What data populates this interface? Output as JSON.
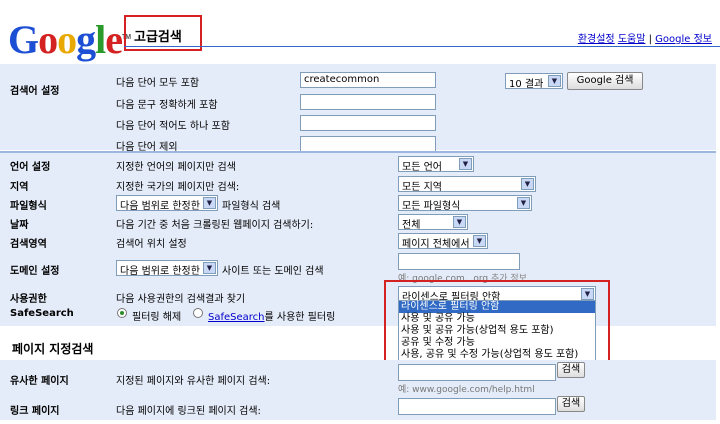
{
  "header": {
    "logo_letters": [
      {
        "ch": "G",
        "color": "#1c4fd4"
      },
      {
        "ch": "o",
        "color": "#d42222"
      },
      {
        "ch": "o",
        "color": "#e8a900"
      },
      {
        "ch": "g",
        "color": "#1c4fd4"
      },
      {
        "ch": "l",
        "color": "#2a9a2a"
      },
      {
        "ch": "e",
        "color": "#d42222"
      }
    ],
    "logo_tm": "TM",
    "title": "고급검색",
    "links": [
      "환경설정",
      "도움말",
      "Google 정보"
    ]
  },
  "search_terms": {
    "section_label": "검색어 설정",
    "rows": [
      {
        "label": "다음 단어 모두 포함",
        "value": "createcommon"
      },
      {
        "label": "다음 문구 정확하게 포함",
        "value": ""
      },
      {
        "label": "다음 단어 적어도 하나 포함",
        "value": ""
      },
      {
        "label": "다음 단어 제외",
        "value": ""
      }
    ],
    "results_select": "10 결과",
    "search_button": "Google 검색"
  },
  "filters": [
    {
      "label": "언어 설정",
      "desc": "지정한 언어의 페이지만 검색",
      "value": "모든 언어"
    },
    {
      "label": "지역",
      "desc": "지정한 국가의 페이지만 검색:",
      "value": "모든 지역"
    },
    {
      "label": "파일형식",
      "pre": "다음 범위로 한정한",
      "desc": "파일형식 검색",
      "value": "모든 파일형식"
    },
    {
      "label": "날짜",
      "desc": "다음 기간 중 처음 크롤링된 웹페이지 검색하기:",
      "value": "전체"
    },
    {
      "label": "검색영역",
      "desc": "검색어 위치 설정",
      "value": "페이지 전체에서"
    },
    {
      "label": "도메인 설정",
      "pre": "다음 범위로 한정한",
      "desc": "사이트 또는 도메인 검색",
      "hint": "예: google.com, .org",
      "hint_link": "추가 정보"
    },
    {
      "label": "사용권한",
      "desc": "다음 사용권한의 검색결과 찾기",
      "value": "라이센스로 필터링 안함"
    }
  ],
  "usage_options": [
    "라이센스로 필터링 안함",
    "사용 및 공유 가능",
    "사용 및 공유 가능(상업적 용도 포함)",
    "공유 및 수정 가능",
    "사용, 공유 및 수정 가능(상업적 용도 포함)"
  ],
  "safesearch": {
    "label": "SafeSearch",
    "off": "필터링 해제",
    "on_link": "SafeSearch",
    "on_suffix": "를 사용한 필터링"
  },
  "page_search": {
    "title": "페이지 지정검색",
    "similar_label": "유사한 페이지",
    "similar_desc": "지정된 페이지와 유사한 페이지 검색:",
    "similar_hint": "예: www.google.com/help.html",
    "links_label": "링크 페이지",
    "links_desc": "다음 페이지에 링크된 페이지 검색:",
    "button": "검색"
  }
}
